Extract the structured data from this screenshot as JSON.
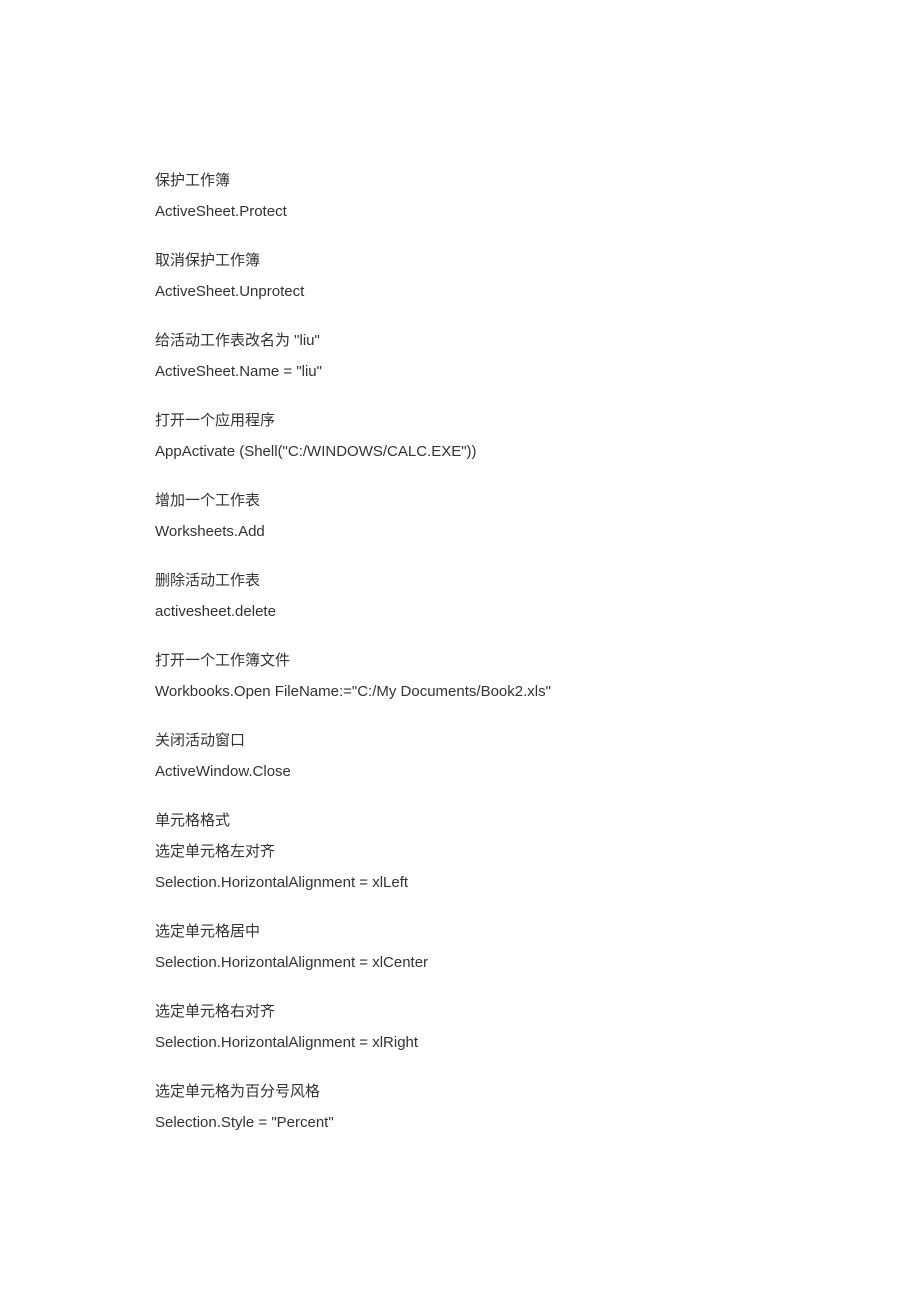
{
  "blocks": [
    {
      "lines": [
        "保护工作簿",
        "ActiveSheet.Protect"
      ]
    },
    {
      "lines": [
        "取消保护工作簿",
        "ActiveSheet.Unprotect"
      ]
    },
    {
      "lines": [
        "给活动工作表改名为  \"liu\"",
        "ActiveSheet.Name = \"liu\""
      ]
    },
    {
      "lines": [
        "打开一个应用程序",
        "AppActivate (Shell(\"C:/WINDOWS/CALC.EXE\"))"
      ]
    },
    {
      "lines": [
        "增加一个工作表",
        "Worksheets.Add"
      ]
    },
    {
      "lines": [
        "删除活动工作表",
        "activesheet.delete"
      ]
    },
    {
      "lines": [
        "打开一个工作簿文件",
        "Workbooks.Open FileName:=\"C:/My Documents/Book2.xls\""
      ]
    },
    {
      "lines": [
        "关闭活动窗口",
        "ActiveWindow.Close"
      ]
    },
    {
      "lines": [
        "单元格格式",
        "选定单元格左对齐",
        "Selection.HorizontalAlignment = xlLeft"
      ]
    },
    {
      "lines": [
        "选定单元格居中",
        "Selection.HorizontalAlignment = xlCenter"
      ]
    },
    {
      "lines": [
        "选定单元格右对齐",
        "Selection.HorizontalAlignment = xlRight"
      ]
    },
    {
      "lines": [
        "选定单元格为百分号风格",
        "Selection.Style = \"Percent\""
      ]
    }
  ]
}
